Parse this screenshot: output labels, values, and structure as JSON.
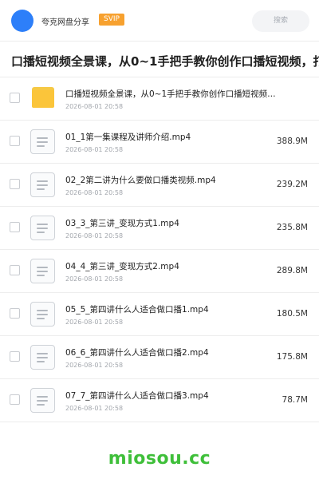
{
  "header": {
    "brand": "夸克网盘分享",
    "badge": "SVIP",
    "search_label": "搜索"
  },
  "title": "口播短视频全景课，从0~1手把手教你创作口播短视频，打",
  "title_overflow": "xxx",
  "items": [
    {
      "type": "folder",
      "name": "口播短视频全景课，从0~1手把手教你创作口播短视频…",
      "date": "2026-08-01 20:58",
      "size": ""
    },
    {
      "type": "file",
      "name": "01_1第一集课程及讲师介绍.mp4",
      "date": "2026-08-01 20:58",
      "size": "388.9M"
    },
    {
      "type": "file",
      "name": "02_2第二讲为什么要做口播类视频.mp4",
      "date": "2026-08-01 20:58",
      "size": "239.2M"
    },
    {
      "type": "file",
      "name": "03_3_第三讲_变现方式1.mp4",
      "date": "2026-08-01 20:58",
      "size": "235.8M"
    },
    {
      "type": "file",
      "name": "04_4_第三讲_变现方式2.mp4",
      "date": "2026-08-01 20:58",
      "size": "289.8M"
    },
    {
      "type": "file",
      "name": "05_5_第四讲什么人适合做口播1.mp4",
      "date": "2026-08-01 20:58",
      "size": "180.5M"
    },
    {
      "type": "file",
      "name": "06_6_第四讲什么人适合做口播2.mp4",
      "date": "2026-08-01 20:58",
      "size": "175.8M"
    },
    {
      "type": "file",
      "name": "07_7_第四讲什么人适合做口播3.mp4",
      "date": "2026-08-01 20:58",
      "size": "78.7M"
    }
  ],
  "watermark": "miosou.cc",
  "colors": {
    "accent": "#2d7ff9",
    "badge": "#f7a12f",
    "folder": "#fbc53a",
    "watermark": "#3fbf3a"
  },
  "icons": {
    "avatar": "avatar-circle",
    "folder": "folder-icon",
    "file": "video-file-icon"
  }
}
